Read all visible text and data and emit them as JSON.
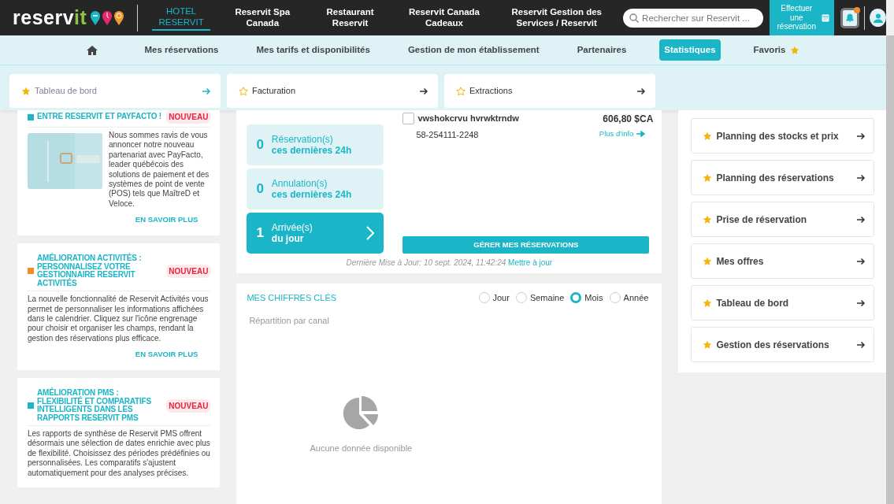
{
  "header": {
    "logo": {
      "main": "reserv",
      "accent": "it"
    },
    "nav": [
      {
        "label": "HOTEL RESERVIT",
        "selected": true
      },
      {
        "label": "Reservit Spa Canada",
        "selected": false
      },
      {
        "label": "Restaurant Reservit",
        "selected": false
      },
      {
        "label": "Reservit Canada Cadeaux",
        "selected": false
      },
      {
        "label": "Reservit Gestion des Services / Reservit",
        "selected": false
      }
    ],
    "search": {
      "placeholder": "Rechercher sur Reservit ..."
    },
    "book_button": "Effectuer une réservation",
    "notifications": {
      "unread": true
    }
  },
  "menu": [
    {
      "kind": "home",
      "selected": false
    },
    {
      "kind": "text",
      "label": "Mes réservations",
      "selected": false
    },
    {
      "kind": "text",
      "label": "Mes tarifs et disponibilités",
      "selected": false
    },
    {
      "kind": "text",
      "label": "Gestion de mon établissement",
      "selected": false
    },
    {
      "kind": "text",
      "label": "Partenaires",
      "selected": false
    },
    {
      "kind": "text",
      "label": "Statistiques",
      "selected": true
    },
    {
      "kind": "favorites",
      "label": "Favoris",
      "selected": false
    }
  ],
  "favorites_bar": [
    {
      "label": "Tableau de bord",
      "starred": true,
      "hovered": true
    },
    {
      "label": "Facturation",
      "starred": false,
      "hovered": false
    },
    {
      "label": "Extractions",
      "starred": false,
      "hovered": false
    }
  ],
  "news": [
    {
      "title": "ENTRE RESERVIT ET PAYFACTO !",
      "color": "#1ab5c6",
      "badge": "NOUVEAU",
      "kind": "picture",
      "body": "Nous sommes ravis de vous annoncer notre nouveau partenariat avec PayFacto, leader québécois des solutions de paiement et des systèmes de point de vente (POS) tels que MaîtreD et Veloce.",
      "link": "EN SAVOIR PLUS"
    },
    {
      "title": "AMÉLIORATION ACTIVITÉS : PERSONNALISEZ VOTRE GESTIONNAIRE RESERVIT ACTIVITÉS",
      "color": "#f28c28",
      "badge": "NOUVEAU",
      "kind": "text",
      "body": "La nouvelle fonctionnalité de Reservit Activités vous permet de personnaliser les informations affichées dans le calendrier. Cliquez sur l'icône engrenage pour choisir et organiser les champs, rendant la gestion des réservations plus efficace.",
      "link": "EN SAVOIR PLUS"
    },
    {
      "title": "AMÉLIORATION PMS : FLEXIBILITÉ ET COMPARATIFS INTELLIGENTS DANS LES RAPPORTS RESERVIT PMS",
      "color": "#1ab5c6",
      "badge": "NOUVEAU",
      "kind": "text",
      "body": "Les rapports de synthèse de Reservit PMS offrent désormais une sélection de dates enrichie avec plus de flexibilité. Choisissez des périodes prédéfinies ou personnalisées. Les comparatifs s'ajustent automatiquement pour des analyses précises."
    }
  ],
  "stats": [
    {
      "count": "0",
      "label": "Réservation(s)",
      "sublabel": "ces dernières 24h",
      "selected": false
    },
    {
      "count": "0",
      "label": "Annulation(s)",
      "sublabel": "ces dernières 24h",
      "selected": false
    },
    {
      "count": "1",
      "label": "Arrivée(s)",
      "sublabel": "du jour",
      "selected": true
    }
  ],
  "reservations": [
    {
      "name": "vwshokcrvu hvrwktrndw",
      "reference": "58-254111-2248",
      "amount": "606,80 $CA",
      "more": "Plus d'info",
      "checked": false
    }
  ],
  "manage_button": "GÉRER MES RÉSERVATIONS",
  "last_update": {
    "text": "Dernière Mise à Jour: 10 sept. 2024, 11:42:24",
    "link": "Mettre à jour"
  },
  "key_figures": {
    "title": "MES CHIFFRES CLÉS",
    "periods": [
      {
        "label": "Jour",
        "selected": false
      },
      {
        "label": "Semaine",
        "selected": false
      },
      {
        "label": "Mois",
        "selected": true
      },
      {
        "label": "Année",
        "selected": false
      }
    ],
    "chart_title": "Répartition par canal",
    "empty_text": "Aucune donnée disponible"
  },
  "shortcuts": [
    {
      "label": "Planning des stocks et prix"
    },
    {
      "label": "Planning des réservations"
    },
    {
      "label": "Prise de réservation"
    },
    {
      "label": "Mes offres"
    },
    {
      "label": "Tableau de bord"
    },
    {
      "label": "Gestion des réservations"
    }
  ]
}
